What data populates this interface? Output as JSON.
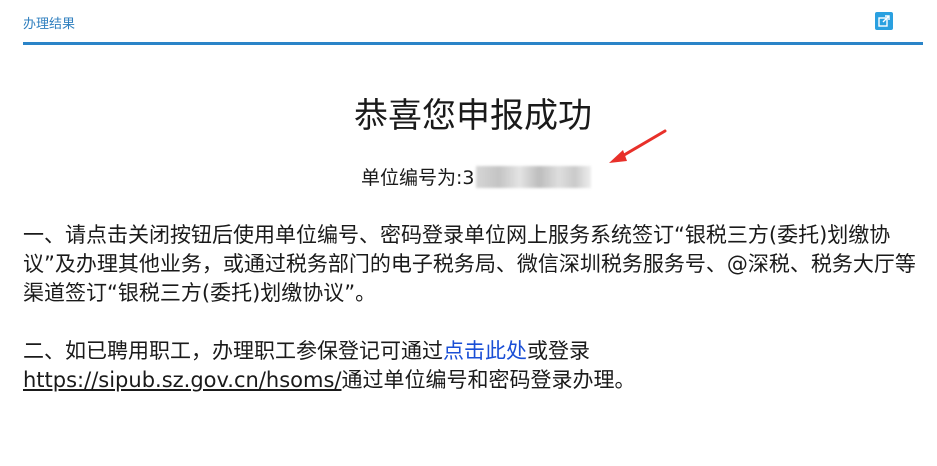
{
  "header": {
    "title": "办理结果",
    "popout_icon": "external-link-icon"
  },
  "main": {
    "title": "恭喜您申报成功",
    "unit_number_label": "单位编号为:",
    "unit_number_visible": "3"
  },
  "paragraph1": {
    "text": "一、请点击关闭按钮后使用单位编号、密码登录单位网上服务系统签订“银税三方(委托)划缴协议”及办理其他业务，或通过税务部门的电子税务局、微信深圳税务服务号、@深税、税务大厅等渠道签订“银税三方(委托)划缴协议”。"
  },
  "paragraph2": {
    "prefix": "二、如已聘用职工，办理职工参保登记可通过",
    "link_text": "点击此处",
    "middle": "或登录",
    "url": "https://sipub.sz.gov.cn/hsoms/",
    "suffix": "通过单位编号和密码登录办理。"
  },
  "colors": {
    "accent": "#2a84c8",
    "link": "#1a4fd6",
    "arrow": "#e8302a"
  }
}
